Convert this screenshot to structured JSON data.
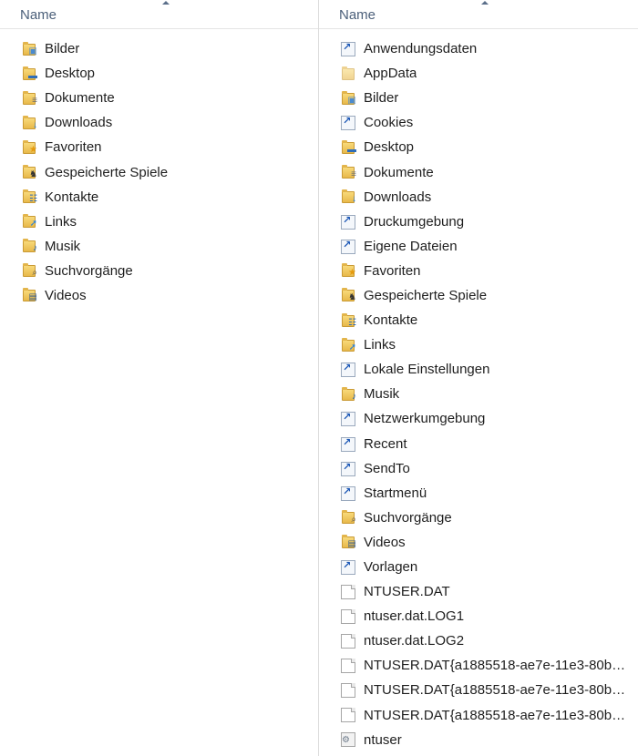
{
  "colors": {
    "header_text": "#4c607a",
    "divider": "#dcdcdc",
    "folder": "#f0c85e",
    "shortcut_arrow": "#1a56b5"
  },
  "left_pane": {
    "header": "Name",
    "items": [
      {
        "label": "Bilder",
        "icon": "folder-pictures-icon"
      },
      {
        "label": "Desktop",
        "icon": "folder-desktop-icon"
      },
      {
        "label": "Dokumente",
        "icon": "folder-documents-icon"
      },
      {
        "label": "Downloads",
        "icon": "folder-downloads-icon"
      },
      {
        "label": "Favoriten",
        "icon": "folder-favorites-icon"
      },
      {
        "label": "Gespeicherte Spiele",
        "icon": "folder-saved-games-icon"
      },
      {
        "label": "Kontakte",
        "icon": "folder-contacts-icon"
      },
      {
        "label": "Links",
        "icon": "folder-links-icon"
      },
      {
        "label": "Musik",
        "icon": "folder-music-icon"
      },
      {
        "label": "Suchvorgänge",
        "icon": "folder-searches-icon"
      },
      {
        "label": "Videos",
        "icon": "folder-videos-icon"
      }
    ]
  },
  "right_pane": {
    "header": "Name",
    "items": [
      {
        "label": "Anwendungsdaten",
        "icon": "shortcut-icon"
      },
      {
        "label": "AppData",
        "icon": "folder-hidden-icon"
      },
      {
        "label": "Bilder",
        "icon": "folder-pictures-icon"
      },
      {
        "label": "Cookies",
        "icon": "shortcut-icon"
      },
      {
        "label": "Desktop",
        "icon": "folder-desktop-icon"
      },
      {
        "label": "Dokumente",
        "icon": "folder-documents-icon"
      },
      {
        "label": "Downloads",
        "icon": "folder-downloads-icon"
      },
      {
        "label": "Druckumgebung",
        "icon": "shortcut-icon"
      },
      {
        "label": "Eigene Dateien",
        "icon": "shortcut-icon"
      },
      {
        "label": "Favoriten",
        "icon": "folder-favorites-icon"
      },
      {
        "label": "Gespeicherte Spiele",
        "icon": "folder-saved-games-icon"
      },
      {
        "label": "Kontakte",
        "icon": "folder-contacts-icon"
      },
      {
        "label": "Links",
        "icon": "folder-links-icon"
      },
      {
        "label": "Lokale Einstellungen",
        "icon": "shortcut-icon"
      },
      {
        "label": "Musik",
        "icon": "folder-music-icon"
      },
      {
        "label": "Netzwerkumgebung",
        "icon": "shortcut-icon"
      },
      {
        "label": "Recent",
        "icon": "shortcut-icon"
      },
      {
        "label": "SendTo",
        "icon": "shortcut-icon"
      },
      {
        "label": "Startmenü",
        "icon": "shortcut-icon"
      },
      {
        "label": "Suchvorgänge",
        "icon": "folder-searches-icon"
      },
      {
        "label": "Videos",
        "icon": "folder-videos-icon"
      },
      {
        "label": "Vorlagen",
        "icon": "shortcut-icon"
      },
      {
        "label": "NTUSER.DAT",
        "icon": "file-icon"
      },
      {
        "label": "ntuser.dat.LOG1",
        "icon": "file-icon"
      },
      {
        "label": "ntuser.dat.LOG2",
        "icon": "file-icon"
      },
      {
        "label": "NTUSER.DAT{a1885518-ae7e-11e3-80ba-...",
        "icon": "file-icon"
      },
      {
        "label": "NTUSER.DAT{a1885518-ae7e-11e3-80ba-...",
        "icon": "file-icon"
      },
      {
        "label": "NTUSER.DAT{a1885518-ae7e-11e3-80ba-...",
        "icon": "file-icon"
      },
      {
        "label": "ntuser",
        "icon": "settings-file-icon"
      }
    ]
  }
}
